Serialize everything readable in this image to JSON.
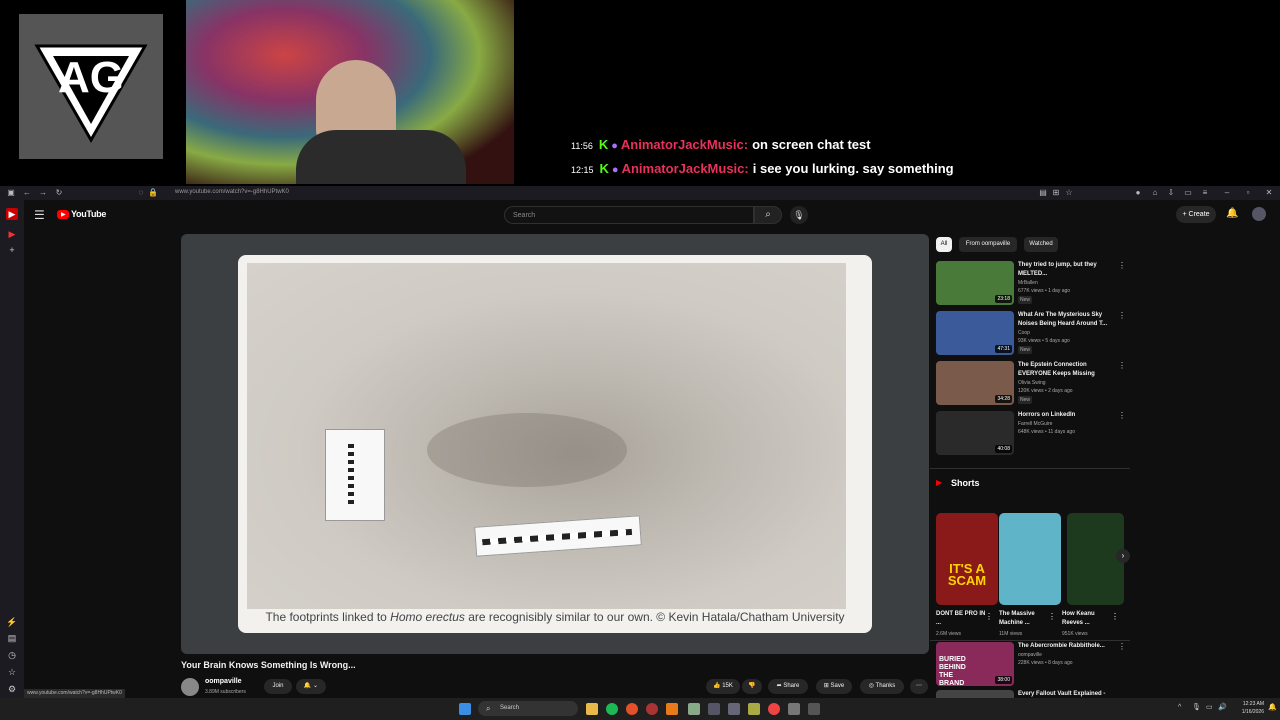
{
  "overlay": {
    "logo_letters": "AG",
    "chat": [
      {
        "time": "11:56",
        "user": "AnimatorJackMusic",
        "message": "on screen chat test"
      },
      {
        "time": "12:15",
        "user": "AnimatorJackMusic",
        "message": "i see you lurking. say something"
      }
    ]
  },
  "browser": {
    "url": "www.youtube.com/watch?v=-g8HhUPtwK0",
    "status_url": "www.youtube.com/watch?v=-g8HhUPtwK0"
  },
  "youtube": {
    "brand": "YouTube",
    "search_placeholder": "Search",
    "create_label": "Create",
    "video": {
      "caption_pre": "The footprints linked to ",
      "caption_italic": "Homo erectus",
      "caption_post": " are recognisibly similar to our own. © Kevin Hatala/Chatham University",
      "title": "Your Brain Knows Something Is Wrong...",
      "channel": "oompaville",
      "subscribers": "3.89M subscribers",
      "join_label": "Join",
      "likes": "15K",
      "share_label": "Share",
      "save_label": "Save",
      "thanks_label": "Thanks"
    },
    "chips": [
      "All",
      "From oompaville",
      "Watched"
    ],
    "recommendations": [
      {
        "title": "They tried to jump, but they MELTED...",
        "channel": "MrBallen",
        "meta": "677K views • 1 day ago",
        "badge": "New",
        "duration": "23:18",
        "thumb_color": "#4a7a3a"
      },
      {
        "title": "What Are The Mysterious Sky Noises Being Heard Around T...",
        "channel": "Coop",
        "meta": "93K views • 5 days ago",
        "badge": "New",
        "duration": "47:31",
        "thumb_color": "#3a5a9a"
      },
      {
        "title": "The Epstein Connection EVERYONE Keeps Missing",
        "channel": "Olivia Swing",
        "meta": "120K views • 2 days ago",
        "badge": "New",
        "duration": "34:28",
        "thumb_color": "#7a5a4a"
      },
      {
        "title": "Horrors on LinkedIn",
        "channel": "Farrell McGuire",
        "meta": "648K views • 11 days ago",
        "badge": "",
        "duration": "40:08",
        "thumb_color": "#2a2a2a"
      }
    ],
    "shorts_heading": "Shorts",
    "shorts": [
      {
        "title": "DONT BE PRO IN ...",
        "views": "2.6M views",
        "overlay": "IT'S A SCAM",
        "color": "#8a1a1a"
      },
      {
        "title": "The Massive Machine ...",
        "views": "11M views",
        "overlay": "",
        "color": "#5fb4c8"
      },
      {
        "title": "How Keanu Reeves ...",
        "views": "951K views",
        "overlay": "",
        "color": "#1e3a1e"
      }
    ],
    "bottom_recs": [
      {
        "title": "The Abercrombie Rabbithole...",
        "channel": "oompaville",
        "meta": "228K views • 8 days ago",
        "duration": "38:00",
        "thumb_color": "#8a2a5a",
        "overlay": "BURIED BEHIND THE BRAND"
      },
      {
        "title": "Every Fallout Vault Explained -",
        "channel": "",
        "meta": "",
        "duration": "",
        "thumb_color": "#444",
        "overlay": ""
      }
    ]
  },
  "taskbar": {
    "search_label": "Search",
    "time": "12:23 AM",
    "date": "1/16/2026"
  }
}
